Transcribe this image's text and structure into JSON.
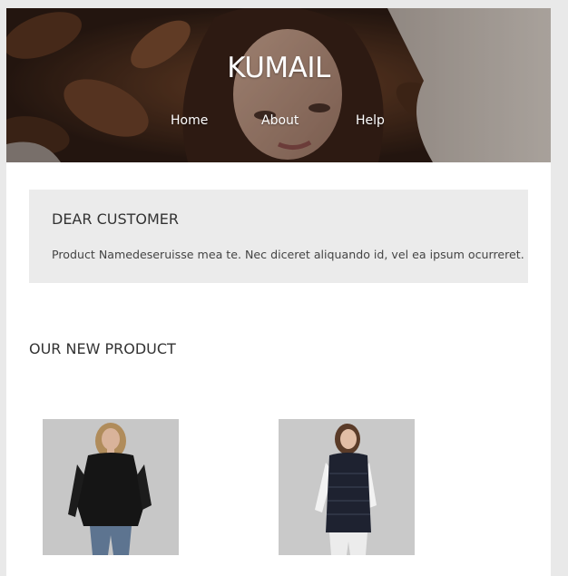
{
  "brand": "KUMAIL",
  "nav": {
    "home": "Home",
    "about": "About",
    "help": "Help"
  },
  "notice": {
    "title": "DEAR CUSTOMER",
    "text": "Product Namedeseruisse mea te. Nec diceret aliquando id, vel ea ipsum ocurreret."
  },
  "products_section": {
    "title": "OUR NEW PRODUCT"
  },
  "colors": {
    "page_background": "#e9e9e9",
    "content_background": "#ffffff",
    "notice_background": "#ebebeb",
    "text_dark": "#333333"
  }
}
